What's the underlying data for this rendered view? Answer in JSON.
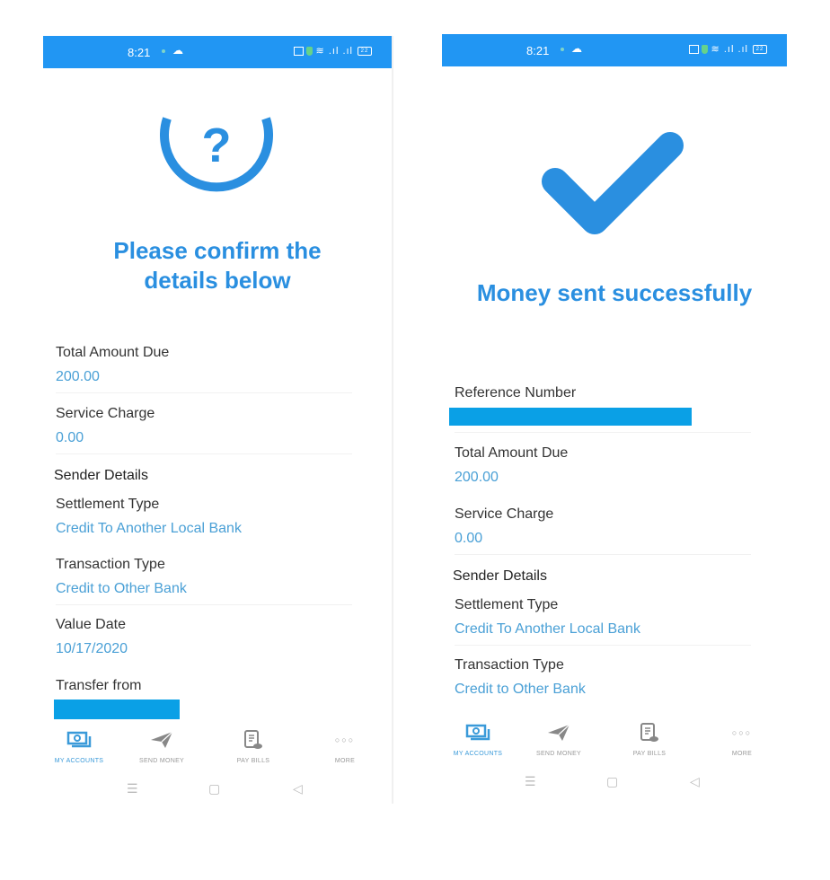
{
  "colors": {
    "accent": "#2196f3",
    "title": "#2a8fe0",
    "value": "#4aa0d6",
    "redaction": "#0aa0e6"
  },
  "status_bar": {
    "time": "8:21"
  },
  "left_screen": {
    "hero_icon": "question-circle-icon",
    "title_line1": "Please confirm the",
    "title_line2": "details below",
    "fields": [
      {
        "label": "Total Amount Due",
        "value": "200.00"
      },
      {
        "label": "Service Charge",
        "value": "0.00"
      }
    ],
    "section_heading": "Sender Details",
    "sender_fields": [
      {
        "label": "Settlement Type",
        "value": "Credit To Another Local Bank"
      },
      {
        "label": "Transaction Type",
        "value": "Credit to Other Bank"
      },
      {
        "label": "Value Date",
        "value": "10/17/2020"
      },
      {
        "label": "Transfer from",
        "value": ""
      }
    ]
  },
  "right_screen": {
    "hero_icon": "checkmark-icon",
    "title": "Money sent successfully",
    "reference": {
      "label": "Reference Number",
      "value": ""
    },
    "fields": [
      {
        "label": "Total Amount Due",
        "value": "200.00"
      },
      {
        "label": "Service Charge",
        "value": "0.00"
      }
    ],
    "section_heading": "Sender Details",
    "sender_fields": [
      {
        "label": "Settlement Type",
        "value": "Credit To Another Local Bank"
      },
      {
        "label": "Transaction Type",
        "value": "Credit to Other Bank"
      }
    ]
  },
  "bottom_nav": [
    {
      "label": "MY ACCOUNTS",
      "icon": "accounts-icon",
      "active": true
    },
    {
      "label": "SEND MONEY",
      "icon": "send-icon",
      "active": false
    },
    {
      "label": "PAY BILLS",
      "icon": "bill-icon",
      "active": false
    },
    {
      "label": "MORE",
      "icon": "more-icon",
      "active": false
    }
  ],
  "system_nav": {
    "menu": "☰",
    "home": "▢",
    "back": "◁"
  }
}
